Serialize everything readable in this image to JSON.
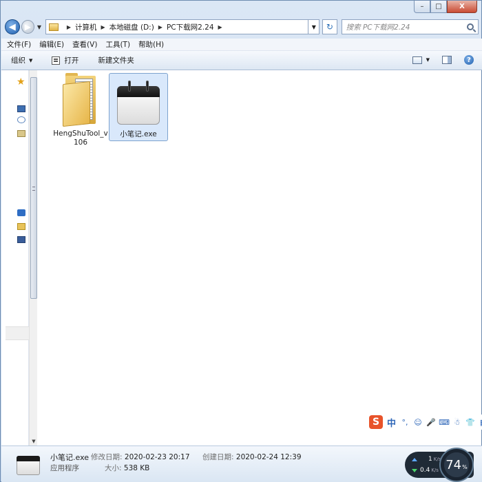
{
  "window": {
    "caption_buttons": {
      "minimize": "–",
      "maximize": "□",
      "close": "X"
    }
  },
  "nav": {
    "back_glyph": "◀",
    "forward_glyph": "▶",
    "history_glyph": "▼"
  },
  "address": {
    "crumbs": [
      "计算机",
      "本地磁盘 (D:)",
      "PC下载网2.24"
    ],
    "refresh_glyph": "↻"
  },
  "search": {
    "placeholder": "搜索 PC下载网2.24"
  },
  "menu": [
    "文件(F)",
    "编辑(E)",
    "查看(V)",
    "工具(T)",
    "帮助(H)"
  ],
  "toolbar": {
    "organize": "组织",
    "open": "打开",
    "new_folder": "新建文件夹",
    "help_glyph": "?"
  },
  "files": [
    {
      "name": "HengShuTool_v106",
      "icon": "folder-icon",
      "selected": false
    },
    {
      "name": "小笔记.exe",
      "icon": "notepad-app-icon",
      "selected": true
    }
  ],
  "ime": {
    "logo": "S",
    "mode": "中",
    "icons": [
      "punctuation-icon",
      "emoji-icon",
      "microphone-icon",
      "keyboard-icon",
      "user-icon",
      "skin-icon",
      "menu-grid-icon"
    ],
    "glyphs": [
      "°,",
      "☺",
      "🎤",
      "⌨",
      "☃",
      "👕",
      "▦"
    ]
  },
  "details": {
    "name": "小笔记.exe",
    "kind": "应用程序",
    "modified_label": "修改日期:",
    "modified_value": "2020-02-23 20:17",
    "created_label": "创建日期:",
    "created_value": "2020-02-24 12:39",
    "size_label": "大小:",
    "size_value": "538 KB"
  },
  "net_monitor": {
    "upload_value": "1",
    "upload_unit": "K/s",
    "download_value": "0.4",
    "download_unit": "K/s",
    "percent": "74",
    "percent_sign": "%"
  },
  "colors": {
    "accent": "#2d66b8",
    "selection": "#d9e8fb",
    "ime_logo": "#e8532a"
  }
}
